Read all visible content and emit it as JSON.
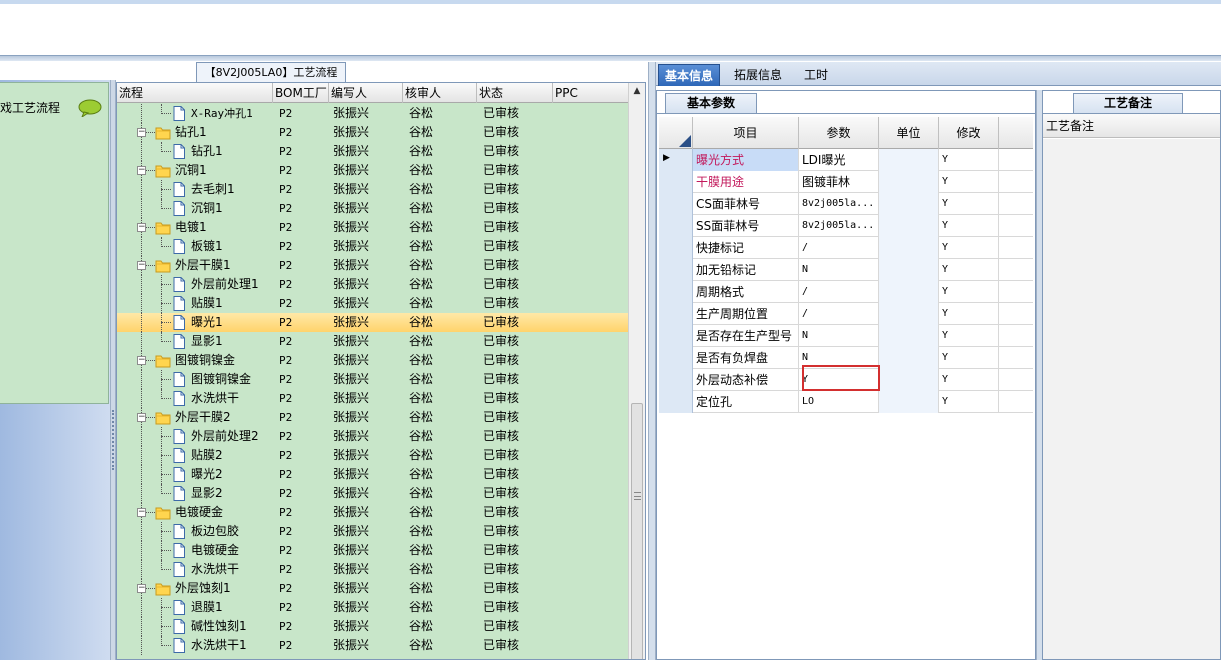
{
  "left_panel": {
    "card_label": "戏工艺流程"
  },
  "tree": {
    "title": "【8V2J005LA0】工艺流程",
    "headers": [
      "流程",
      "BOM工厂",
      "编写人",
      "核审人",
      "状态",
      "PPC"
    ],
    "rows": [
      {
        "name": "X-Ray冲孔1",
        "level": 1,
        "type": "file",
        "bom": "P2",
        "writer": "张振兴",
        "reviewer": "谷松",
        "status": "已审核"
      },
      {
        "name": "钻孔1",
        "level": 0,
        "type": "folder",
        "bom": "P2",
        "writer": "张振兴",
        "reviewer": "谷松",
        "status": "已审核"
      },
      {
        "name": "钻孔1",
        "level": 1,
        "type": "file",
        "bom": "P2",
        "writer": "张振兴",
        "reviewer": "谷松",
        "status": "已审核"
      },
      {
        "name": "沉铜1",
        "level": 0,
        "type": "folder",
        "bom": "P2",
        "writer": "张振兴",
        "reviewer": "谷松",
        "status": "已审核"
      },
      {
        "name": "去毛刺1",
        "level": 1,
        "type": "file",
        "bom": "P2",
        "writer": "张振兴",
        "reviewer": "谷松",
        "status": "已审核"
      },
      {
        "name": "沉铜1",
        "level": 1,
        "type": "file",
        "bom": "P2",
        "writer": "张振兴",
        "reviewer": "谷松",
        "status": "已审核"
      },
      {
        "name": "电镀1",
        "level": 0,
        "type": "folder",
        "bom": "P2",
        "writer": "张振兴",
        "reviewer": "谷松",
        "status": "已审核"
      },
      {
        "name": "板镀1",
        "level": 1,
        "type": "file",
        "bom": "P2",
        "writer": "张振兴",
        "reviewer": "谷松",
        "status": "已审核"
      },
      {
        "name": "外层干膜1",
        "level": 0,
        "type": "folder",
        "bom": "P2",
        "writer": "张振兴",
        "reviewer": "谷松",
        "status": "已审核"
      },
      {
        "name": "外层前处理1",
        "level": 1,
        "type": "file",
        "bom": "P2",
        "writer": "张振兴",
        "reviewer": "谷松",
        "status": "已审核"
      },
      {
        "name": "贴膜1",
        "level": 1,
        "type": "file",
        "bom": "P2",
        "writer": "张振兴",
        "reviewer": "谷松",
        "status": "已审核"
      },
      {
        "name": "曝光1",
        "level": 1,
        "type": "file",
        "bom": "P2",
        "writer": "张振兴",
        "reviewer": "谷松",
        "status": "已审核",
        "selected": true
      },
      {
        "name": "显影1",
        "level": 1,
        "type": "file",
        "bom": "P2",
        "writer": "张振兴",
        "reviewer": "谷松",
        "status": "已审核"
      },
      {
        "name": "图镀铜镍金",
        "level": 0,
        "type": "folder",
        "bom": "P2",
        "writer": "张振兴",
        "reviewer": "谷松",
        "status": "已审核"
      },
      {
        "name": "图镀铜镍金",
        "level": 1,
        "type": "file",
        "bom": "P2",
        "writer": "张振兴",
        "reviewer": "谷松",
        "status": "已审核"
      },
      {
        "name": "水洗烘干",
        "level": 1,
        "type": "file",
        "bom": "P2",
        "writer": "张振兴",
        "reviewer": "谷松",
        "status": "已审核"
      },
      {
        "name": "外层干膜2",
        "level": 0,
        "type": "folder",
        "bom": "P2",
        "writer": "张振兴",
        "reviewer": "谷松",
        "status": "已审核"
      },
      {
        "name": "外层前处理2",
        "level": 1,
        "type": "file",
        "bom": "P2",
        "writer": "张振兴",
        "reviewer": "谷松",
        "status": "已审核"
      },
      {
        "name": "贴膜2",
        "level": 1,
        "type": "file",
        "bom": "P2",
        "writer": "张振兴",
        "reviewer": "谷松",
        "status": "已审核"
      },
      {
        "name": "曝光2",
        "level": 1,
        "type": "file",
        "bom": "P2",
        "writer": "张振兴",
        "reviewer": "谷松",
        "status": "已审核"
      },
      {
        "name": "显影2",
        "level": 1,
        "type": "file",
        "bom": "P2",
        "writer": "张振兴",
        "reviewer": "谷松",
        "status": "已审核"
      },
      {
        "name": "电镀硬金",
        "level": 0,
        "type": "folder",
        "bom": "P2",
        "writer": "张振兴",
        "reviewer": "谷松",
        "status": "已审核"
      },
      {
        "name": "板边包胶",
        "level": 1,
        "type": "file",
        "bom": "P2",
        "writer": "张振兴",
        "reviewer": "谷松",
        "status": "已审核"
      },
      {
        "name": "电镀硬金",
        "level": 1,
        "type": "file",
        "bom": "P2",
        "writer": "张振兴",
        "reviewer": "谷松",
        "status": "已审核"
      },
      {
        "name": "水洗烘干",
        "level": 1,
        "type": "file",
        "bom": "P2",
        "writer": "张振兴",
        "reviewer": "谷松",
        "status": "已审核"
      },
      {
        "name": "外层蚀刻1",
        "level": 0,
        "type": "folder",
        "bom": "P2",
        "writer": "张振兴",
        "reviewer": "谷松",
        "status": "已审核"
      },
      {
        "name": "退膜1",
        "level": 1,
        "type": "file",
        "bom": "P2",
        "writer": "张振兴",
        "reviewer": "谷松",
        "status": "已审核"
      },
      {
        "name": "碱性蚀刻1",
        "level": 1,
        "type": "file",
        "bom": "P2",
        "writer": "张振兴",
        "reviewer": "谷松",
        "status": "已审核"
      },
      {
        "name": "水洗烘干1",
        "level": 1,
        "type": "file",
        "bom": "P2",
        "writer": "张振兴",
        "reviewer": "谷松",
        "status": "已审核"
      }
    ]
  },
  "tabs": [
    {
      "label": "基本信息",
      "active": true
    },
    {
      "label": "拓展信息",
      "active": false
    },
    {
      "label": "工时",
      "active": false
    }
  ],
  "params": {
    "sub_tab": "基本参数",
    "headers": [
      "项目",
      "参数",
      "单位",
      "修改"
    ],
    "rows": [
      {
        "item": "曝光方式",
        "value": "LDI曝光",
        "unit": "",
        "modify": "Y",
        "item_color": "#c2185b",
        "current": true
      },
      {
        "item": "干膜用途",
        "value": "图镀菲林",
        "unit": "",
        "modify": "Y",
        "item_color": "#c2185b"
      },
      {
        "item": "CS面菲林号",
        "value": "8v2j005la...",
        "unit": "",
        "modify": "Y"
      },
      {
        "item": "SS面菲林号",
        "value": "8v2j005la...",
        "unit": "",
        "modify": "Y"
      },
      {
        "item": "快捷标记",
        "value": "/",
        "unit": "",
        "modify": "Y"
      },
      {
        "item": "加无铅标记",
        "value": "N",
        "unit": "",
        "modify": "Y"
      },
      {
        "item": "周期格式",
        "value": "/",
        "unit": "",
        "modify": "Y"
      },
      {
        "item": "生产周期位置",
        "value": "/",
        "unit": "",
        "modify": "Y"
      },
      {
        "item": "是否存在生产型号",
        "value": "N",
        "unit": "",
        "modify": "Y"
      },
      {
        "item": "是否有负焊盘",
        "value": "N",
        "unit": "",
        "modify": "Y"
      },
      {
        "item": "外层动态补偿",
        "value": "Y",
        "unit": "",
        "modify": "Y"
      },
      {
        "item": "定位孔",
        "value": "LO",
        "unit": "",
        "modify": "Y"
      }
    ]
  },
  "notes": {
    "tab": "工艺备注",
    "header": "工艺备注"
  },
  "colors": {
    "tree_bg": "#c8e6c9",
    "selected_row": "#ffd36b",
    "highlight_box": "#d32f2f",
    "active_tab": "#2e67b8"
  }
}
